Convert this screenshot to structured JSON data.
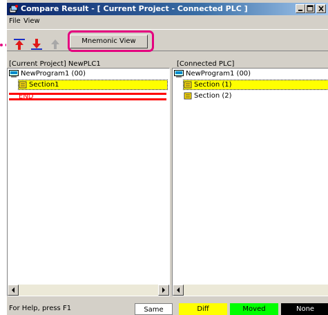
{
  "window": {
    "title": "Compare Result - [ Current Project  -  Connected PLC ]"
  },
  "menu": {
    "file": "File",
    "view": "View"
  },
  "toolbar": {
    "mnemonic_label": "Mnemonic View"
  },
  "left_panel": {
    "header": "[Current Project] NewPLC1",
    "rows": [
      {
        "label": "NewProgram1 (00)"
      },
      {
        "label": "Section1"
      },
      {
        "label": "END"
      }
    ]
  },
  "right_panel": {
    "header": "[Connected PLC]",
    "rows": [
      {
        "label": "NewProgram1 (00)"
      },
      {
        "label": "Section (1)"
      },
      {
        "label": "Section (2)"
      }
    ]
  },
  "status": {
    "help": "For Help, press F1",
    "legend": [
      {
        "label": "Same",
        "color": "#ffffff"
      },
      {
        "label": "Diff",
        "color": "#ffff00"
      },
      {
        "label": "Moved",
        "color": "#00ff00"
      },
      {
        "label": "None",
        "color": "#000000"
      }
    ]
  },
  "colors": {
    "highlight": "#e4007f",
    "diff": "#ffff00",
    "missing": "#ff0000"
  }
}
